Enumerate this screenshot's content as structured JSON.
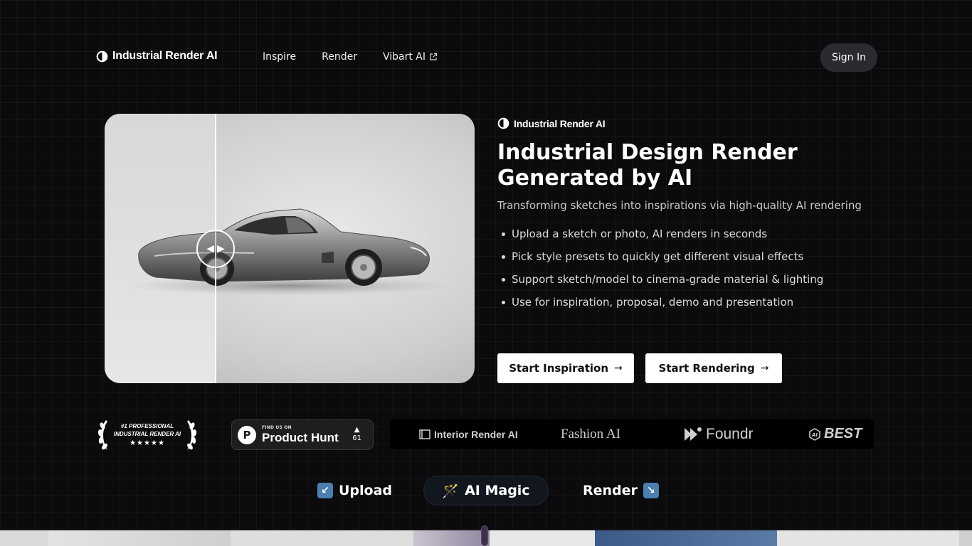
{
  "header": {
    "brand": "Industrial Render AI",
    "nav": [
      {
        "label": "Inspire"
      },
      {
        "label": "Render"
      },
      {
        "label": "Vibart AI",
        "icon": "external-link-icon"
      }
    ],
    "signin_label": "Sign In"
  },
  "hero": {
    "brand": "Industrial Render AI",
    "title": "Industrial Design Render Generated by AI",
    "subtitle": "Transforming sketches into inspirations via high-quality AI rendering",
    "features": [
      "Upload a sketch or photo, AI renders in seconds",
      "Pick style presets to quickly get different visual effects",
      "Support sketch/model to cinema-grade material & lighting",
      "Use for inspiration, proposal, demo and presentation"
    ],
    "buttons": {
      "inspiration": "Start Inspiration",
      "rendering": "Start Rendering",
      "arrow": "→"
    },
    "compare_split": 0.3
  },
  "badges": {
    "award_line1": "#1 PROFESSIONAL",
    "award_line2": "INDUSTRIAL RENDER AI",
    "award_stars": "★★★★★",
    "producthunt": {
      "small": "FIND US ON",
      "big": "Product Hunt",
      "arrow": "▲",
      "votes": "61"
    },
    "logos": {
      "interior": "Interior Render AI",
      "fashion": "Fashion AI",
      "foundr": "Foundr",
      "best": "BEST"
    }
  },
  "steps": {
    "upload": "Upload",
    "upload_emoji": "↙",
    "magic": "AI Magic",
    "magic_emoji": "🪄",
    "render": "Render",
    "render_emoji": "↘"
  },
  "colors": {
    "background": "#0b0a0c",
    "button_bg": "#ffffff",
    "signin_bg": "#2b2a2e",
    "step_active_bg": "#12161f",
    "emoji_blue": "#4a7fb0"
  }
}
